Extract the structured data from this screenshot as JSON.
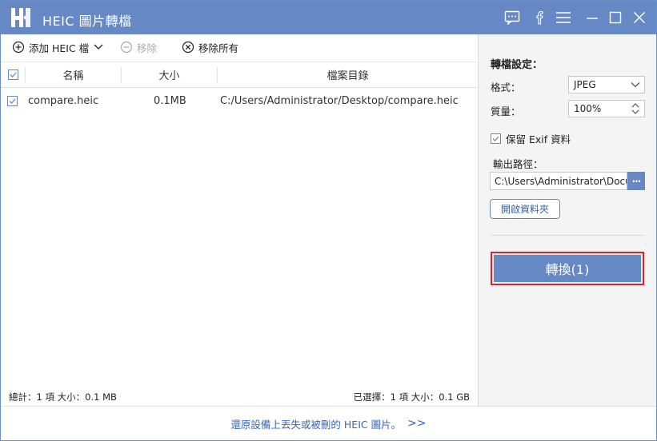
{
  "app": {
    "title": "HEIC 圖片轉檔",
    "accent_color": "#6688c4"
  },
  "titlebar_icons": [
    "chat-icon",
    "facebook-icon",
    "menu-icon",
    "minimize-icon",
    "maximize-icon",
    "close-icon"
  ],
  "toolbar": {
    "add_label": "添加 HEIC 檔",
    "remove_label": "移除",
    "remove_all_label": "移除所有"
  },
  "table": {
    "headers": {
      "name": "名稱",
      "size": "大小",
      "dir": "檔案目錄"
    },
    "rows": [
      {
        "checked": true,
        "name": "compare.heic",
        "size": "0.1MB",
        "dir": "C:/Users/Administrator/Desktop/compare.heic"
      }
    ]
  },
  "status": {
    "total": "總計：1 項 大小：0.1 MB",
    "selected": "已選擇：1 項 大小：0.1 GB"
  },
  "settings": {
    "title": "轉檔設定：",
    "format_label": "格式：",
    "format_value": "JPEG",
    "quality_label": "質量：",
    "quality_value": "100%",
    "exif_label": "保留 Exif 資料",
    "exif_checked": true,
    "output_label": "輸出路徑：",
    "output_value": "C:\\Users\\Administrator\\Documents",
    "browse_label": "···",
    "open_folder_label": "開啟資料夾",
    "convert_label": "轉換(1)",
    "convert_highlight_color": "#d9252f"
  },
  "footer": {
    "link_text": "還原設備上丟失或被刪的 HEIC 圖片。",
    "link_chevron": ">>"
  }
}
